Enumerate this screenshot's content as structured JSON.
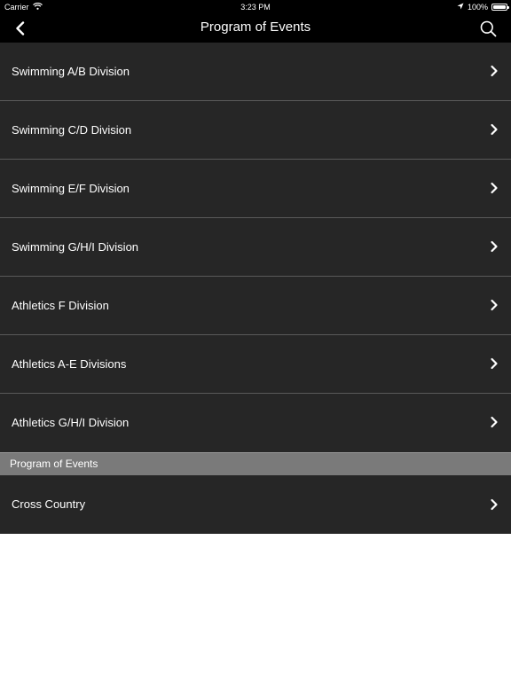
{
  "status_bar": {
    "carrier": "Carrier",
    "time": "3:23 PM",
    "battery": "100%",
    "battery_level": 1.0
  },
  "nav": {
    "title": "Program of Events",
    "back_icon": "chevron-left-icon",
    "search_icon": "search-icon"
  },
  "items": [
    {
      "label": "Swimming A/B Division"
    },
    {
      "label": "Swimming C/D Division"
    },
    {
      "label": "Swimming E/F Division"
    },
    {
      "label": "Swimming G/H/I Division"
    },
    {
      "label": "Athletics F Division"
    },
    {
      "label": "Athletics A-E Divisions"
    },
    {
      "label": "Athletics G/H/I Division"
    }
  ],
  "section": {
    "header": "Program of Events",
    "items": [
      {
        "label": "Cross Country"
      }
    ]
  },
  "colors": {
    "bar_background": "#000000",
    "row_background": "#262626",
    "section_header_background": "#7a7a7a",
    "text": "#ffffff"
  }
}
